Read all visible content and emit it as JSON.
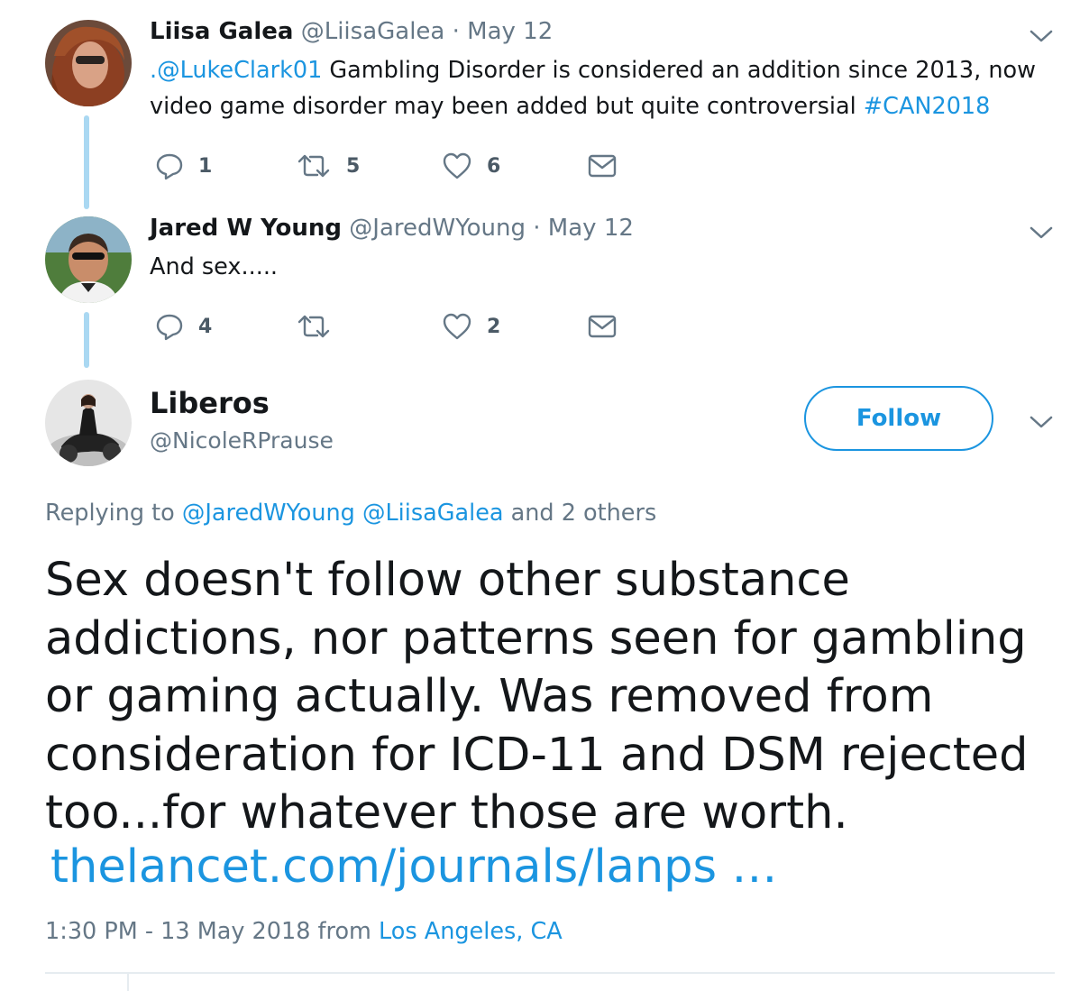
{
  "tweets": [
    {
      "name": "Liisa Galea",
      "handle": "@LiisaGalea",
      "date": "· May 12",
      "mention": ".@LukeClark01",
      "text_line1": " Gambling Disorder is considered an addition since 2013, now",
      "text_line2": "video game disorder may been added but quite controversial ",
      "hashtag": "#CAN2018",
      "reply_count": "1",
      "retweet_count": "5",
      "like_count": "6"
    },
    {
      "name": "Jared W Young",
      "handle": "@JaredWYoung",
      "date": "· May 12",
      "text": "And sex.....",
      "reply_count": "4",
      "retweet_count": "",
      "like_count": "2"
    }
  ],
  "main": {
    "name": "Liberos",
    "handle": "@NicoleRPrause",
    "follow_label": "Follow",
    "replying_prefix": "Replying to ",
    "replying_mention1": "@JaredWYoung",
    "replying_mention2": "@LiisaGalea",
    "replying_suffix": " and 2 others",
    "text": "Sex doesn't follow other substance addictions, nor patterns seen for gambling or gaming actually. Was removed from consideration for ICD-11 and DSM rejected too...for whatever those are worth.",
    "link": "thelancet.com/journals/lanps  …",
    "timestamp": "1:30 PM - 13 May 2018 from ",
    "location": "Los Angeles, CA"
  },
  "icons": {
    "reply": "reply-icon",
    "retweet": "retweet-icon",
    "like": "heart-icon",
    "dm": "envelope-icon",
    "caret": "chevron-down-icon"
  },
  "colors": {
    "link": "#1b95e0",
    "meta": "#657786",
    "thread_line": "#aad8f2"
  }
}
